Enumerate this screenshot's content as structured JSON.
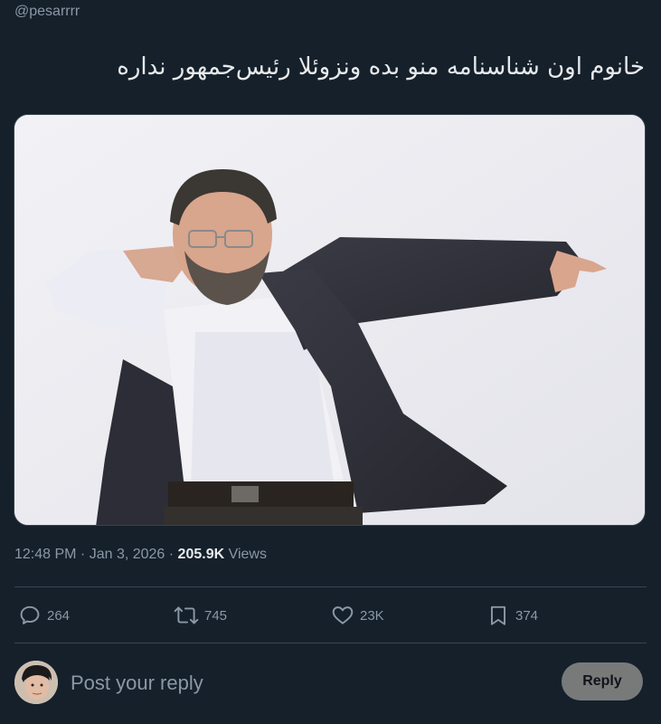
{
  "tweet": {
    "handle": "@pesarrrr",
    "text": "خانوم اون شناسنامه منو بده ونزوئلا رئیس‌جمهور نداره",
    "time": "12:48 PM",
    "separator1": " · ",
    "date": "Jan 3, 2026",
    "separator2": " · ",
    "views_count": "205.9K",
    "views_label": " Views"
  },
  "actions": {
    "replies": "264",
    "retweets": "745",
    "likes": "23K",
    "bookmarks": "374"
  },
  "reply": {
    "placeholder": "Post your reply",
    "button_label": "Reply"
  },
  "icons": {
    "reply": "speech-bubble-icon",
    "retweet": "retweet-icon",
    "like": "heart-icon",
    "bookmark": "bookmark-icon"
  },
  "colors": {
    "background": "#15202b",
    "text": "#e7e9ea",
    "muted": "#8b98a5",
    "divider": "#38444d",
    "reply_button": "#787a7a"
  }
}
